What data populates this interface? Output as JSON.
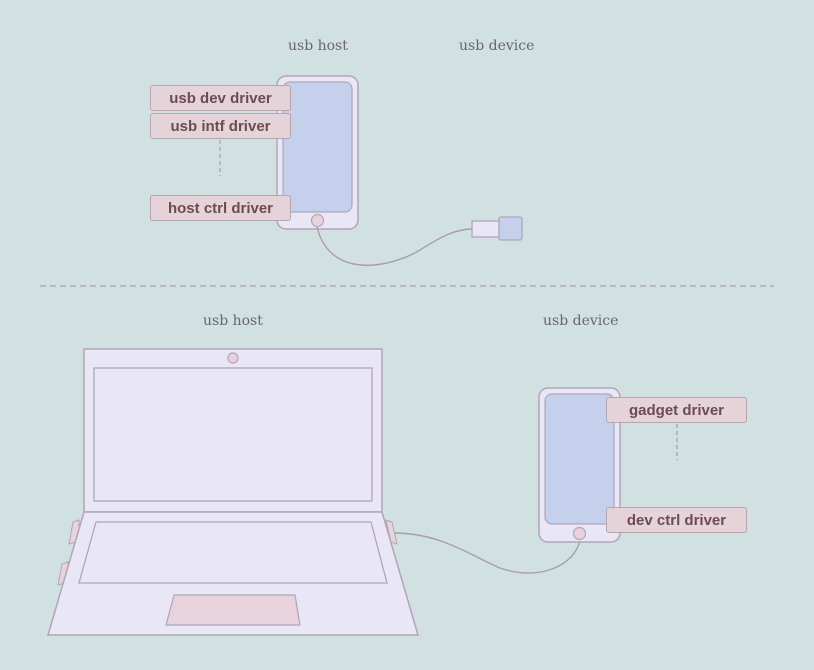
{
  "top": {
    "host_label": "usb host",
    "device_label": "usb device",
    "drivers": {
      "dev_driver": "usb dev driver",
      "intf_driver": "usb intf driver",
      "host_ctrl_driver": "host ctrl driver"
    }
  },
  "bottom": {
    "host_label": "usb host",
    "device_label": "usb device",
    "drivers": {
      "gadget_driver": "gadget driver",
      "dev_ctrl_driver": "dev ctrl driver"
    }
  },
  "colors": {
    "background": "#d1e1e2",
    "outline": "#b0a5b9",
    "device_body": "#e9e7f6",
    "screen": "#c5d0ec",
    "driver_fill": "#e5d3da",
    "driver_text": "#6e4b52",
    "trackpad": "#e8d3dc",
    "label_text": "#6b6470"
  }
}
